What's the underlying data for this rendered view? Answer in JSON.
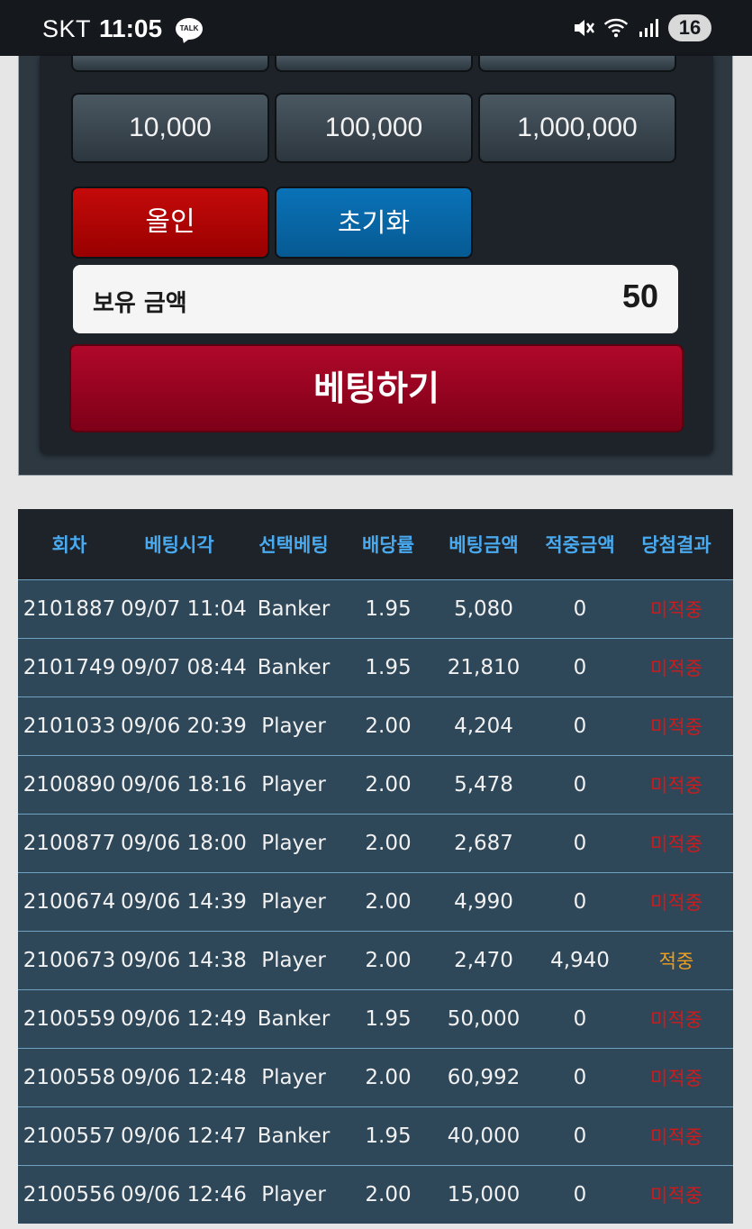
{
  "status_bar": {
    "carrier": "SKT",
    "time": "11:05",
    "talk_badge": "TALK",
    "battery": "16"
  },
  "bet_panel": {
    "chips_row": [
      "10,000",
      "100,000",
      "1,000,000"
    ],
    "allin_label": "올인",
    "reset_label": "초기화",
    "balance_label": "보유 금액",
    "balance_value": "50",
    "bet_label": "베팅하기"
  },
  "history": {
    "columns": [
      "회차",
      "베팅시각",
      "선택베팅",
      "배당률",
      "베팅금액",
      "적중금액",
      "당첨결과"
    ],
    "rows": [
      [
        "2101887",
        "09/07 11:04",
        "Banker",
        "1.95",
        "5,080",
        "0",
        "미적중"
      ],
      [
        "2101749",
        "09/07 08:44",
        "Banker",
        "1.95",
        "21,810",
        "0",
        "미적중"
      ],
      [
        "2101033",
        "09/06 20:39",
        "Player",
        "2.00",
        "4,204",
        "0",
        "미적중"
      ],
      [
        "2100890",
        "09/06 18:16",
        "Player",
        "2.00",
        "5,478",
        "0",
        "미적중"
      ],
      [
        "2100877",
        "09/06 18:00",
        "Player",
        "2.00",
        "2,687",
        "0",
        "미적중"
      ],
      [
        "2100674",
        "09/06 14:39",
        "Player",
        "2.00",
        "4,990",
        "0",
        "미적중"
      ],
      [
        "2100673",
        "09/06 14:38",
        "Player",
        "2.00",
        "2,470",
        "4,940",
        "적중"
      ],
      [
        "2100559",
        "09/06 12:49",
        "Banker",
        "1.95",
        "50,000",
        "0",
        "미적중"
      ],
      [
        "2100558",
        "09/06 12:48",
        "Player",
        "2.00",
        "60,992",
        "0",
        "미적중"
      ],
      [
        "2100557",
        "09/06 12:47",
        "Banker",
        "1.95",
        "40,000",
        "0",
        "미적중"
      ],
      [
        "2100556",
        "09/06 12:46",
        "Player",
        "2.00",
        "15,000",
        "0",
        "미적중"
      ]
    ]
  },
  "colors": {
    "header_text": "#4aaaf0",
    "row_bg": "#2e4759",
    "lose": "#d21a1a",
    "win": "#f0a020"
  }
}
